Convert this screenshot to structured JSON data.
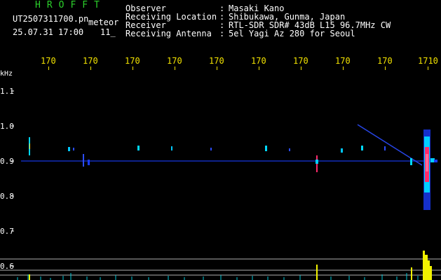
{
  "header": {
    "brand": "HROFFT",
    "filename": "UT2507311700.pn",
    "tag": "meteor",
    "datetime": "25.07.31 17:00",
    "minute": "11_",
    "meta_labels": [
      "Observer",
      "Receiving Location",
      "Receiver",
      "Receiving Antenna"
    ],
    "meta_colons": [
      ":",
      ":",
      ":",
      ":"
    ],
    "meta_values": [
      "Masaki Kano",
      "Shibukawa, Gunma, Japan",
      "RTL-SDR SDR# 43dB L15 96.7MHz CW",
      "5el Yagi Az 280 for Seoul"
    ]
  },
  "time_axis": {
    "labels": [
      "170",
      "170",
      "170",
      "170",
      "170",
      "170",
      "170",
      "170",
      "170",
      "1710"
    ]
  },
  "freq_axis": {
    "unit": "kHz",
    "labels": [
      "1.1",
      "1.0",
      "0.9",
      "0.8",
      "0.7",
      "0.6"
    ]
  },
  "colors": {
    "text": "#ffffff",
    "brand": "#2bd12b",
    "axis": "#f2e200",
    "signal_low": "#1a3cff",
    "signal_mid": "#00d0ff",
    "signal_high": "#ff2a6a",
    "echo_bar": "#f2f200",
    "noise": "#00c8d8"
  }
}
